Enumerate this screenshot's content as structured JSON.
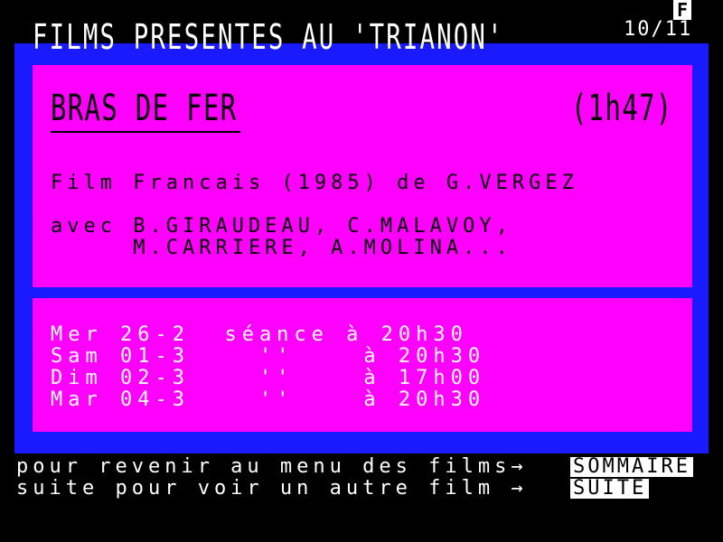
{
  "header": {
    "title": "FILMS PRESENTES AU 'TRIANON'",
    "page_indicator": "10/11",
    "badge": "F"
  },
  "film": {
    "title": "BRAS DE FER",
    "duration": "(1h47)",
    "origin_line": "Film Francais (1985) de G.VERGEZ",
    "cast_line1": "avec B.GIRAUDEAU, C.MALAVOY,",
    "cast_line2": "     M.CARRIERE, A.MOLINA..."
  },
  "schedule": [
    "Mer 26-2  séance à 20h30",
    "Sam 01-3    ''    à 20h30",
    "Dim 02-3    ''    à 17h00",
    "Mar 04-3    ''    à 20h30"
  ],
  "footer": {
    "line1": "pour revenir au menu des films→",
    "line2": "suite pour voir un autre film →",
    "sommaire_label": "SOMMAIRE",
    "suite_label": "SUITE"
  },
  "colors": {
    "background": "#000000",
    "frame": "#1a1aff",
    "panel": "#ff00ff",
    "text_light": "#ffffff",
    "text_dark": "#000000"
  }
}
